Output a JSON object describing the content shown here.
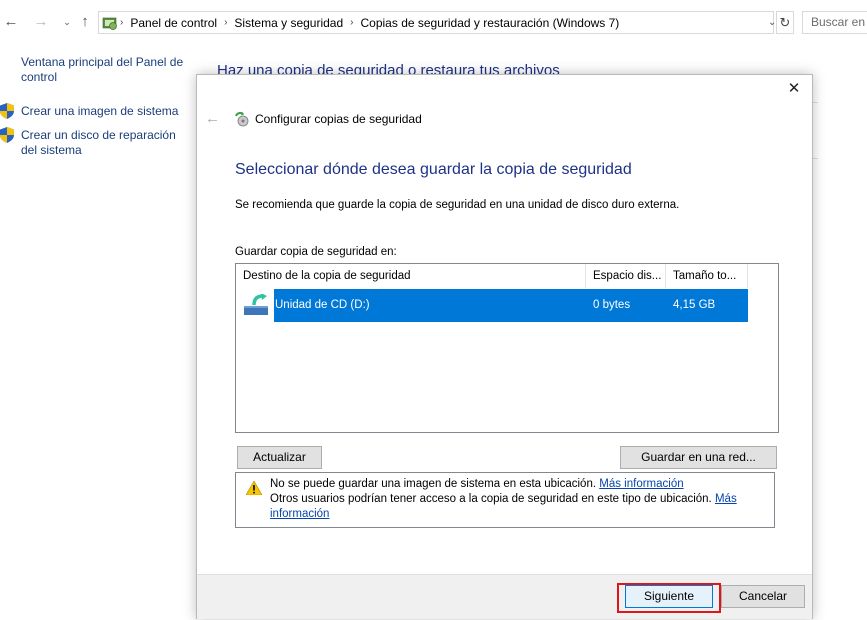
{
  "address_bar": {
    "breadcrumbs": [
      "Panel de control",
      "Sistema y seguridad",
      "Copias de seguridad y restauración (Windows 7)"
    ],
    "search_placeholder": "Buscar en e"
  },
  "left_nav": {
    "items": [
      {
        "label": "Ventana principal del Panel de control",
        "icon": ""
      },
      {
        "label": "Crear una imagen de sistema",
        "icon": "shield-icon"
      },
      {
        "label": "Crear un disco de reparación del sistema",
        "icon": "shield-icon"
      }
    ]
  },
  "background": {
    "heading": "Haz una copia de seguridad o restaura tus archivos"
  },
  "dialog": {
    "title": "Configurar copias de seguridad",
    "main_instruction": "Seleccionar dónde desea guardar la copia de seguridad",
    "recommendation": "Se recomienda que guarde la copia de seguridad en una unidad de disco duro externa.",
    "save_to_label": "Guardar copia de seguridad en:",
    "columns": [
      "Destino de la copia de seguridad",
      "Espacio dis...",
      "Tamaño to..."
    ],
    "rows": [
      {
        "destination": "Unidad de CD (D:)",
        "free_space": "0 bytes",
        "total_size": "4,15 GB",
        "selected": true
      }
    ],
    "refresh_button": "Actualizar",
    "network_button": "Guardar en una red...",
    "warning": {
      "line1": "No se puede guardar una imagen de sistema en esta ubicación.",
      "line1_link": "Más información",
      "line2": "Otros usuarios podrían tener acceso a la copia de seguridad en este tipo de ubicación.",
      "line2_link_part1": "Más",
      "line2_link_part2": "información"
    },
    "next_button": "Siguiente",
    "cancel_button": "Cancelar"
  },
  "colors": {
    "accent": "#0078d7",
    "heading": "#1e3287",
    "link": "#0645ad",
    "highlight": "#e0151a"
  }
}
